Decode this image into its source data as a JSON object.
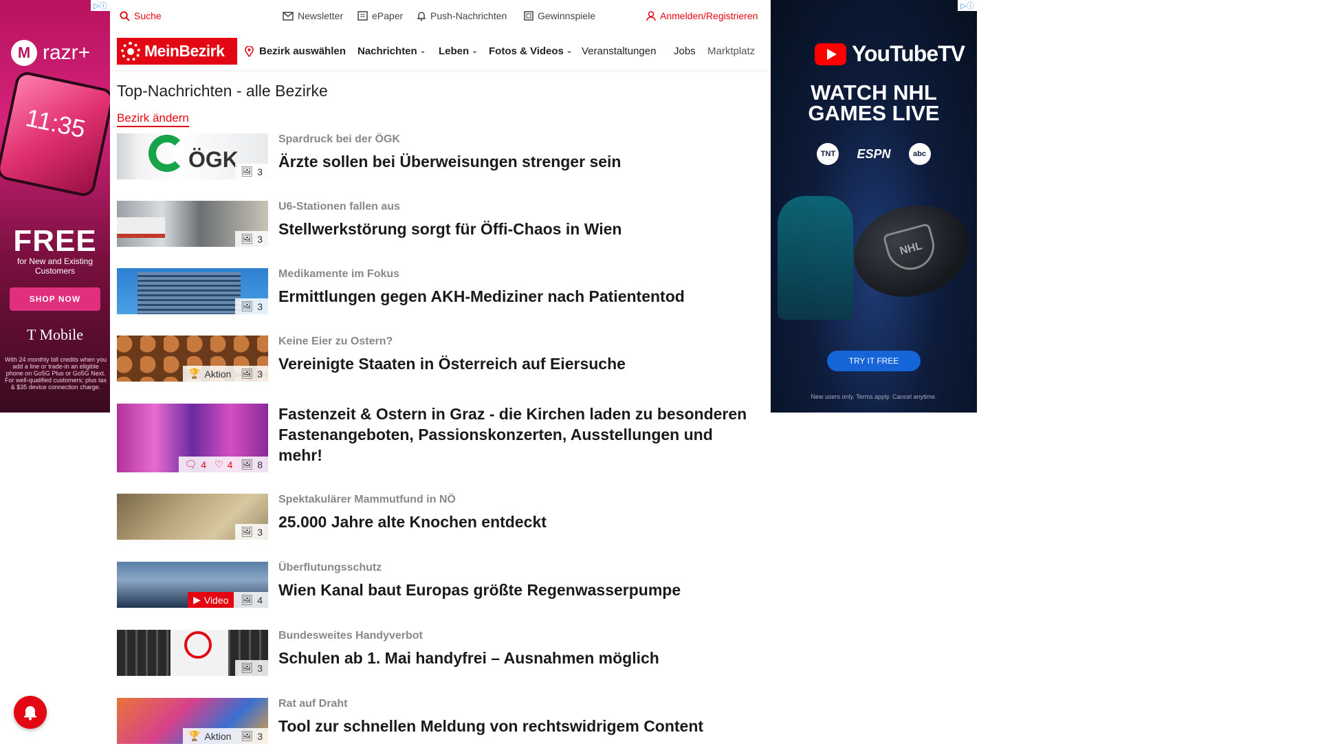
{
  "ad_left": {
    "brand": "razr+",
    "brand_logo": "M",
    "phone_time": "11:35",
    "headline": "FREE",
    "sub": "for New and Existing Customers",
    "cta": "SHOP NOW",
    "advertiser": "T Mobile",
    "fine_print": "With 24 monthly bill credits when you add a line or trade-in an eligible phone on Go5G Plus or Go5G Next. For well-qualified customers; plus tax & $35 device connection charge."
  },
  "ad_right": {
    "brand": "YouTubeTV",
    "headline_line1": "WATCH NHL",
    "headline_line2": "GAMES LIVE",
    "networks": [
      "TNT",
      "ESPN",
      "abc"
    ],
    "puck_logo": "NHL",
    "cta": "TRY IT FREE",
    "fine_print": "New users only. Terms apply. Cancel anytime."
  },
  "topbar": {
    "search": "Suche",
    "newsletter": "Newsletter",
    "epaper": "ePaper",
    "push": "Push-Nachrichten",
    "gewinnspiele": "Gewinnspiele",
    "login": "Anmelden/Registrieren"
  },
  "navbar": {
    "logo": "MeinBezirk",
    "bezirk": "Bezirk auswählen",
    "items": [
      "Nachrichten",
      "Leben",
      "Fotos & Videos",
      "Veranstaltungen",
      "Jobs",
      "Marktplatz"
    ]
  },
  "page": {
    "heading": "Top-Nachrichten - alle Bezirke",
    "change_link": "Bezirk ändern"
  },
  "articles": [
    {
      "kicker": "Spardruck bei der ÖGK",
      "title": "Ärzte sollen bei Überweisungen strenger sein",
      "photos": "3",
      "thumb_text": "ÖGK"
    },
    {
      "kicker": "U6-Stationen fallen aus",
      "title": "Stellwerkstörung sorgt für Öffi-Chaos in Wien",
      "photos": "3"
    },
    {
      "kicker": "Medikamente im Fokus",
      "title": "Ermittlungen gegen AKH-Mediziner nach Patiententod",
      "photos": "3"
    },
    {
      "kicker": "Keine Eier zu Ostern?",
      "title": "Vereinigte Staaten in Österreich auf Eiersuche",
      "photos": "3",
      "action": "Aktion"
    },
    {
      "kicker": "",
      "title": "Fastenzeit & Ostern in Graz - die Kirchen laden zu besonderen Fastenangeboten, Passionskonzerten, Ausstellungen und mehr!",
      "photos": "8",
      "comments": "4",
      "likes": "4"
    },
    {
      "kicker": "Spektakulärer Mammutfund in NÖ",
      "title": "25.000 Jahre alte Knochen entdeckt",
      "photos": "3"
    },
    {
      "kicker": "Überflutungsschutz",
      "title": "Wien Kanal baut Europas größte Regenwasserpumpe",
      "photos": "4",
      "video": "Video"
    },
    {
      "kicker": "Bundesweites Handyverbot",
      "title": "Schulen ab 1. Mai handyfrei – Ausnahmen möglich",
      "photos": "3"
    },
    {
      "kicker": "Rat auf Draht",
      "title": "Tool zur schnellen Meldung von rechtswidrigem Content",
      "photos": "3",
      "action": "Aktion"
    }
  ],
  "colors": {
    "accent": "#e30613",
    "kicker": "#888888"
  }
}
